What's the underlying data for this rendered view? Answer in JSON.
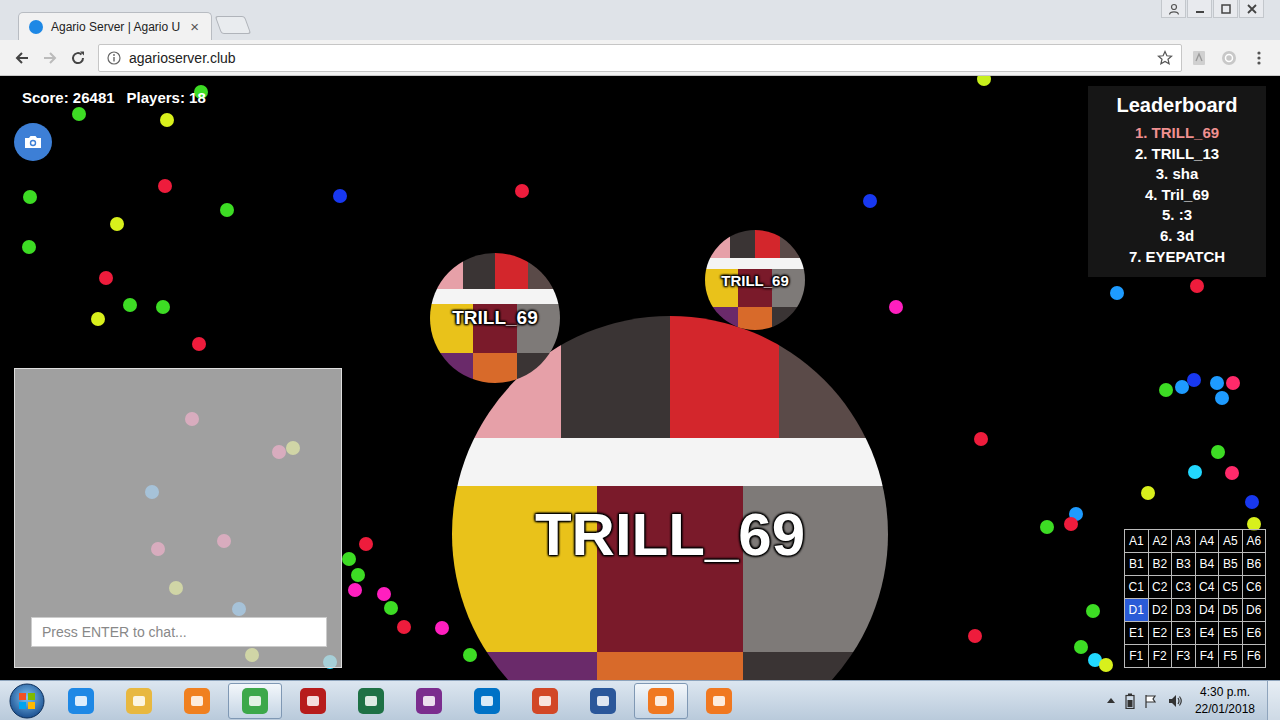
{
  "window": {
    "title": "Agario Server | Agario U",
    "close": "×"
  },
  "address_bar": {
    "url": "agarioserver.club"
  },
  "hud": {
    "score": "Score: 26481",
    "players": "Players: 18"
  },
  "leaderboard": {
    "title": "Leaderboard",
    "entries": [
      {
        "text": "1. TRILL_69",
        "selected": true
      },
      {
        "text": "2. TRILL_13",
        "selected": false
      },
      {
        "text": "3. sha",
        "selected": false
      },
      {
        "text": "4. Tril_69",
        "selected": false
      },
      {
        "text": "5. :3",
        "selected": false
      },
      {
        "text": "6. 3d",
        "selected": false
      },
      {
        "text": "7. EYEPATCH",
        "selected": false
      }
    ]
  },
  "cells": [
    {
      "name": "TRILL_69"
    },
    {
      "name": "TRILL_69"
    },
    {
      "name": "TRILL_69"
    }
  ],
  "chat": {
    "placeholder": "Press ENTER to chat..."
  },
  "minimap": {
    "cells": [
      {
        "label": "A1",
        "selected": false
      },
      {
        "label": "A2",
        "selected": false
      },
      {
        "label": "A3",
        "selected": false
      },
      {
        "label": "A4",
        "selected": false
      },
      {
        "label": "A5",
        "selected": false
      },
      {
        "label": "A6",
        "selected": false
      },
      {
        "label": "B1",
        "selected": false
      },
      {
        "label": "B2",
        "selected": false
      },
      {
        "label": "B3",
        "selected": false
      },
      {
        "label": "B4",
        "selected": false
      },
      {
        "label": "B5",
        "selected": false
      },
      {
        "label": "B6",
        "selected": false
      },
      {
        "label": "C1",
        "selected": false
      },
      {
        "label": "C2",
        "selected": false
      },
      {
        "label": "C3",
        "selected": false
      },
      {
        "label": "C4",
        "selected": false
      },
      {
        "label": "C5",
        "selected": false
      },
      {
        "label": "C6",
        "selected": false
      },
      {
        "label": "D1",
        "selected": true
      },
      {
        "label": "D2",
        "selected": false
      },
      {
        "label": "D3",
        "selected": false
      },
      {
        "label": "D4",
        "selected": false
      },
      {
        "label": "D5",
        "selected": false
      },
      {
        "label": "D6",
        "selected": false
      },
      {
        "label": "E1",
        "selected": false
      },
      {
        "label": "E2",
        "selected": false
      },
      {
        "label": "E3",
        "selected": false
      },
      {
        "label": "E4",
        "selected": false
      },
      {
        "label": "E5",
        "selected": false
      },
      {
        "label": "E6",
        "selected": false
      },
      {
        "label": "F1",
        "selected": false
      },
      {
        "label": "F2",
        "selected": false
      },
      {
        "label": "F3",
        "selected": false
      },
      {
        "label": "F4",
        "selected": false
      },
      {
        "label": "F5",
        "selected": false
      },
      {
        "label": "F6",
        "selected": false
      }
    ]
  },
  "food": [
    {
      "color": "#3ddc24"
    },
    {
      "color": "#3ddc24"
    },
    {
      "color": "#d8f01c"
    },
    {
      "color": "#c8f01c"
    },
    {
      "color": "#3ddc24"
    },
    {
      "color": "#ee1c3c"
    },
    {
      "color": "#d8f01c"
    },
    {
      "color": "#3ddc24"
    },
    {
      "color": "#1838f0"
    },
    {
      "color": "#ee1c3c"
    },
    {
      "color": "#1838f0"
    },
    {
      "color": "#3ddc24"
    },
    {
      "color": "#ee1c3c"
    },
    {
      "color": "#3ddc24"
    },
    {
      "color": "#3ddc24"
    },
    {
      "color": "#d8f01c"
    },
    {
      "color": "#ee1c3c"
    },
    {
      "color": "#1e9bff"
    },
    {
      "color": "#ee1c3c"
    },
    {
      "color": "#ff1fbf"
    },
    {
      "color": "#ee1c3c"
    },
    {
      "color": "#3ddc24"
    },
    {
      "color": "#1e9bff"
    },
    {
      "color": "#1838f0"
    },
    {
      "color": "#1e9bff"
    },
    {
      "color": "#ff2a6a"
    },
    {
      "color": "#1e9bff"
    },
    {
      "color": "#3ddc24"
    },
    {
      "color": "#22d8ff"
    },
    {
      "color": "#ff2a6a"
    },
    {
      "color": "#d8f01c"
    },
    {
      "color": "#1838f0"
    },
    {
      "color": "#1e9bff"
    },
    {
      "color": "#ee1c3c"
    },
    {
      "color": "#3ddc24"
    },
    {
      "color": "#d8f01c"
    },
    {
      "color": "#3ddc24"
    },
    {
      "color": "#ee1c3c"
    },
    {
      "color": "#3ddc24"
    },
    {
      "color": "#22d8ff"
    },
    {
      "color": "#d8f01c"
    },
    {
      "color": "#ee1c3c"
    },
    {
      "color": "#3ddc24"
    },
    {
      "color": "#3ddc24"
    },
    {
      "color": "#ff1fbf"
    },
    {
      "color": "#ff1fbf"
    },
    {
      "color": "#3ddc24"
    },
    {
      "color": "#ee1c3c"
    },
    {
      "color": "#ff1fbf"
    },
    {
      "color": "#3ddc24"
    },
    {
      "color": "#ff3a8a"
    },
    {
      "color": "#ff3a8a"
    },
    {
      "color": "#d8f01c"
    },
    {
      "color": "#1e9bff"
    },
    {
      "color": "#ff3a8a"
    },
    {
      "color": "#ff3a8a"
    },
    {
      "color": "#d8f01c"
    },
    {
      "color": "#1e9bff"
    },
    {
      "color": "#d8f01c"
    },
    {
      "color": "#22d8ff"
    }
  ],
  "taskbar": {
    "apps": [
      {
        "selected": false,
        "color": "#1e88e5"
      },
      {
        "selected": false,
        "color": "#e8b840"
      },
      {
        "selected": false,
        "color": "#f08020"
      },
      {
        "selected": true,
        "color": "#3ca84a"
      },
      {
        "selected": false,
        "color": "#b71c1c"
      },
      {
        "selected": false,
        "color": "#1e7145"
      },
      {
        "selected": false,
        "color": "#7b2d8e"
      },
      {
        "selected": false,
        "color": "#0072c6"
      },
      {
        "selected": false,
        "color": "#d24726"
      },
      {
        "selected": false,
        "color": "#2b579a"
      },
      {
        "selected": true,
        "color": "#f07820"
      },
      {
        "selected": false,
        "color": "#f07820"
      }
    ],
    "clock": {
      "time": "4:30 p.m.",
      "date": "22/01/2018"
    }
  }
}
